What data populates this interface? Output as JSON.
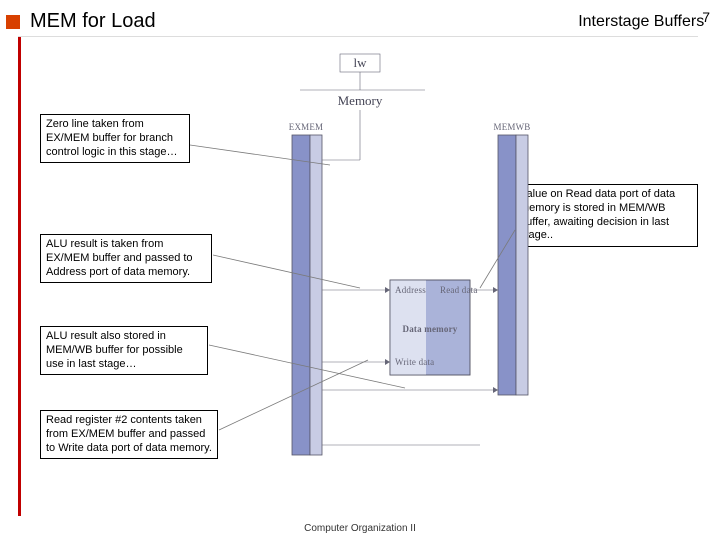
{
  "header": {
    "title": "MEM for Load",
    "right_label": "Interstage Buffers",
    "page_number": "7"
  },
  "annotations": {
    "zero_line": "Zero line taken from EX/MEM buffer for branch control logic in this stage…",
    "alu_address": "ALU result is taken from EX/MEM buffer and passed to Address port of data memory.",
    "alu_store": "ALU result also stored in MEM/WB buffer for possible use in last stage…",
    "read_reg2": "Read register #2 contents taken from EX/MEM buffer and passed to Write data port of data memory.",
    "read_data": "Value on Read data port of data memory is stored in MEM/WB buffer, awaiting decision in last stage.."
  },
  "diagram": {
    "top_sel": "lw",
    "top_label": "Memory",
    "left_buf": "EXMEM",
    "right_buf": "MEMWB",
    "mem_block": "Data memory",
    "port_address": "Address",
    "port_read": "Read data",
    "port_write": "Write data"
  },
  "footer": {
    "text": "Computer Organization II"
  }
}
